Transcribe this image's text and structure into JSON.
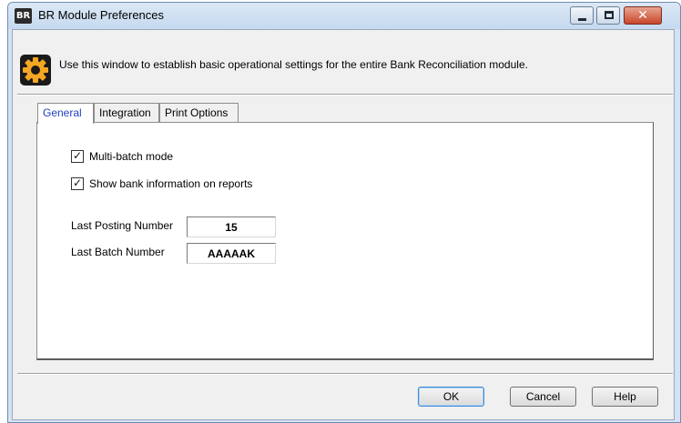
{
  "window": {
    "badge": "BR",
    "title": "BR Module Preferences",
    "close_glyph": "✕"
  },
  "header": {
    "icon": "gear-icon",
    "description": "Use this window to establish basic operational settings for the entire Bank Reconciliation module."
  },
  "tabs": [
    {
      "label": "General",
      "active": true
    },
    {
      "label": "Integration",
      "active": false
    },
    {
      "label": "Print Options",
      "active": false
    }
  ],
  "general": {
    "multi_batch": {
      "label": "Multi-batch mode",
      "checked": true
    },
    "show_bank_info": {
      "label": "Show bank information on reports",
      "checked": true
    },
    "last_posting": {
      "label": "Last Posting Number",
      "value": "15"
    },
    "last_batch": {
      "label": "Last Batch Number",
      "value": "AAAAAK"
    }
  },
  "buttons": {
    "ok": "OK",
    "cancel": "Cancel",
    "help": "Help"
  },
  "colors": {
    "accent": "#f5a623",
    "active_tab_text": "#1f3fbf",
    "close_button": "#c8452b"
  }
}
